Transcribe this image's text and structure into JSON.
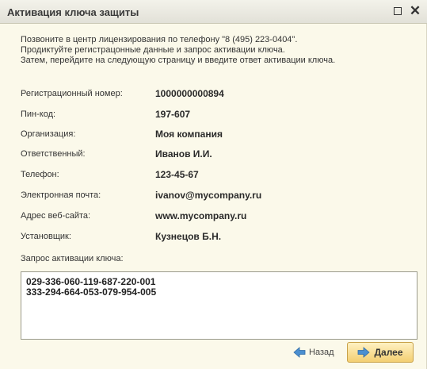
{
  "window": {
    "title": "Активация ключа защиты"
  },
  "intro": [
    "Позвоните в центр лицензирования по телефону \"8 (495) 223-0404\".",
    "Продиктуйте регистрацонные данные и запрос активации ключа.",
    "Затем, перейдите на следующую страницу и введите ответ активации ключа."
  ],
  "fields": [
    {
      "label": "Регистрационный номер:",
      "value": "1000000000894"
    },
    {
      "label": "Пин-код:",
      "value": "197-607"
    },
    {
      "label": "Организация:",
      "value": "Моя компания"
    },
    {
      "label": "Ответственный:",
      "value": "Иванов И.И."
    },
    {
      "label": "Телефон:",
      "value": "123-45-67"
    },
    {
      "label": "Электронная почта:",
      "value": "ivanov@mycompany.ru"
    },
    {
      "label": "Адрес веб-сайта:",
      "value": "www.mycompany.ru"
    },
    {
      "label": "Установщик:",
      "value": "Кузнецов Б.Н."
    }
  ],
  "request": {
    "label": "Запрос активации ключа:",
    "lines": [
      "029-336-060-119-687-220-001",
      "333-294-664-053-079-954-005"
    ]
  },
  "buttons": {
    "back_label": "Назад",
    "next_label": "Далее"
  },
  "colors": {
    "background": "#fbf9ea",
    "next_button": "#f3cf72",
    "arrow_icon": "#4a8fd0"
  }
}
